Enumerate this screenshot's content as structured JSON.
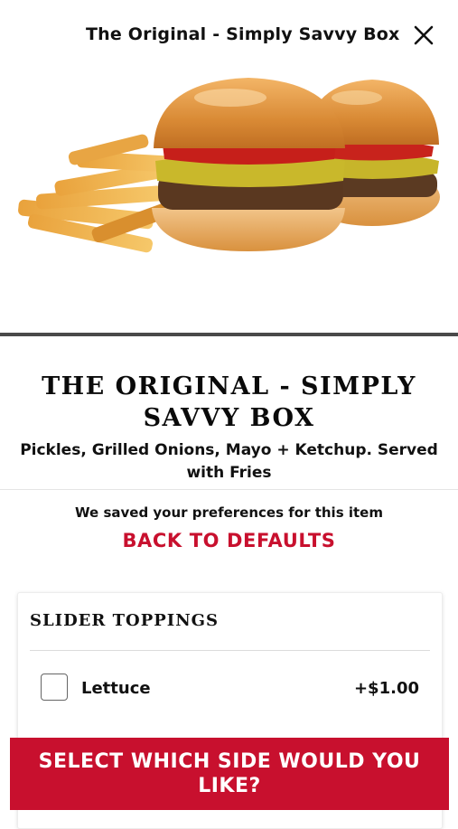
{
  "header": {
    "title": "The Original - Simply Savvy Box",
    "close_icon": "close-icon"
  },
  "hero": {
    "image": "burger-sliders-with-fries-photo"
  },
  "item": {
    "name": "THE ORIGINAL - SIMPLY SAVVY BOX",
    "description": "Pickles, Grilled Onions, Mayo + Ketchup. Served with Fries"
  },
  "preferences": {
    "saved_text": "We saved your preferences for this item",
    "back_to_defaults_label": "BACK TO DEFAULTS"
  },
  "toppings": {
    "section_title": "SLIDER TOPPINGS",
    "options": [
      {
        "label": "Lettuce",
        "price": "+$1.00",
        "checked": false
      }
    ]
  },
  "cta": {
    "label": "SELECT WHICH SIDE WOULD YOU LIKE?"
  },
  "colors": {
    "accent_red": "#c8102e",
    "divider_gray": "#4a4a4a",
    "text_dark": "#111111"
  }
}
